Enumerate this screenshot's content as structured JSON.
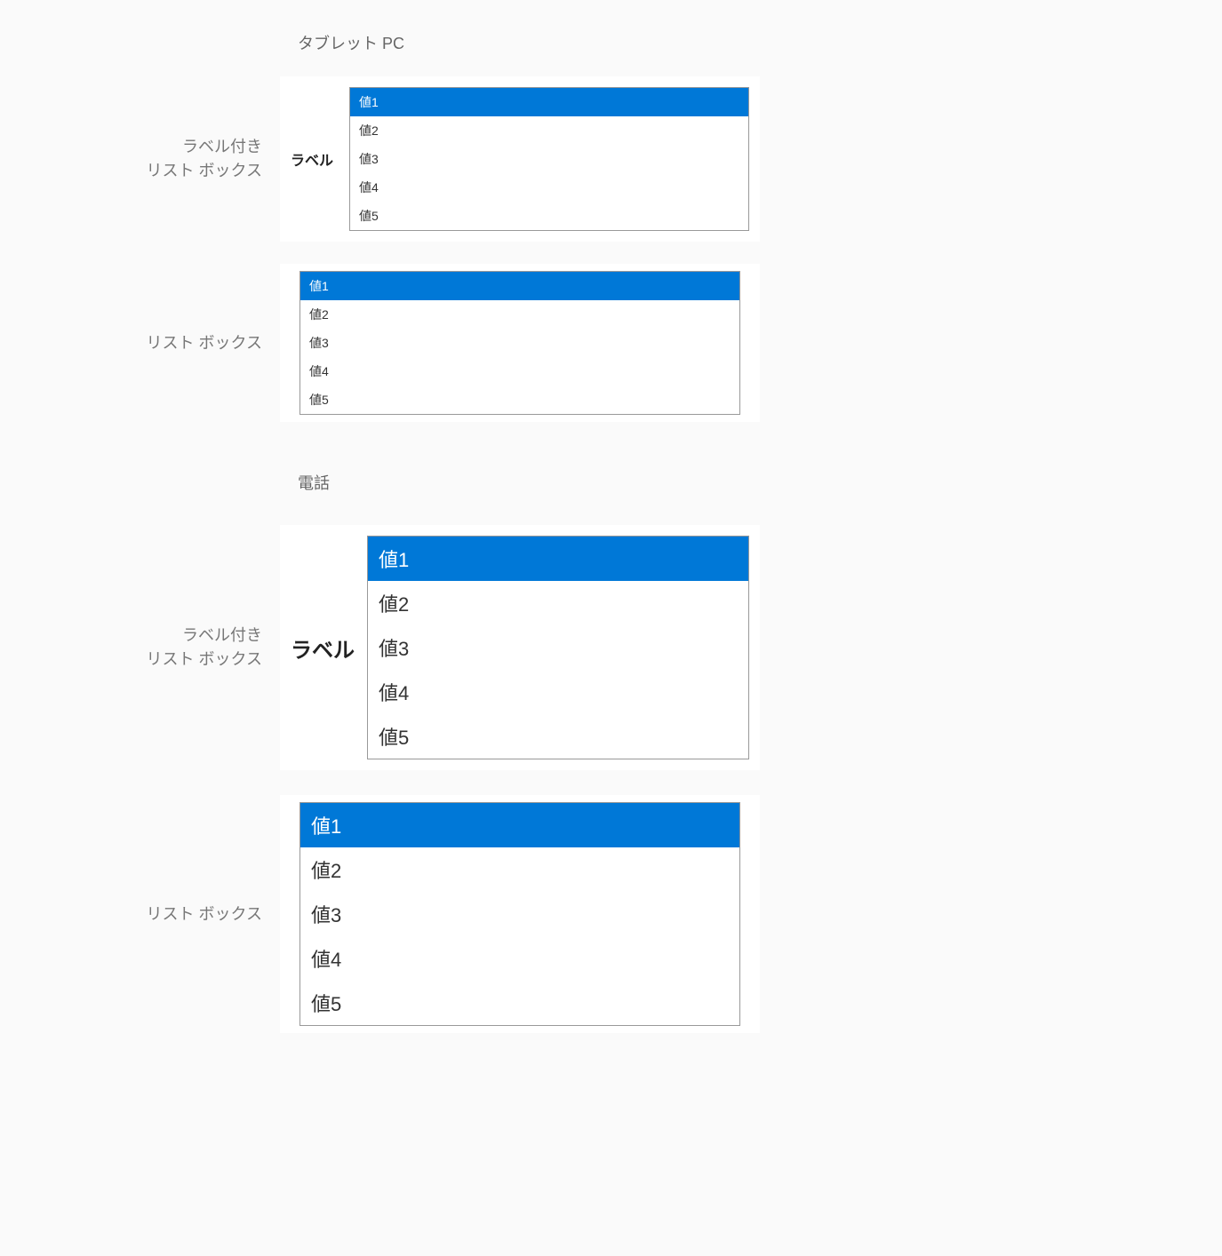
{
  "headings": {
    "tablet": "タブレット PC",
    "phone": "電話"
  },
  "rowLabels": {
    "labeledListBox_line1": "ラベル付き",
    "labeledListBox_line2": "リスト ボックス",
    "listBox": "リスト ボックス"
  },
  "inlineLabel": "ラベル",
  "items": {
    "v1": "値1",
    "v2": "値2",
    "v3": "値3",
    "v4": "値4",
    "v5": "値5"
  }
}
